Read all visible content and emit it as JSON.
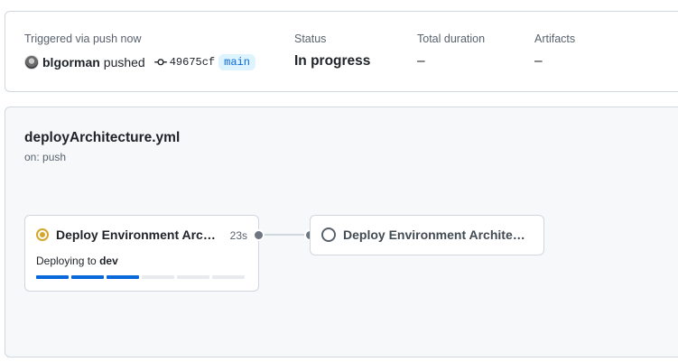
{
  "summary": {
    "triggered_label": "Triggered via push now",
    "user": "blgorman",
    "action": "pushed",
    "commit_sha": "49675cf",
    "branch": "main",
    "status_label": "Status",
    "status_value": "In progress",
    "duration_label": "Total duration",
    "duration_value": "–",
    "artifacts_label": "Artifacts",
    "artifacts_value": "–"
  },
  "workflow": {
    "file_name": "deployArchitecture.yml",
    "trigger": "on: push",
    "jobs": [
      {
        "name": "Deploy Environment Archit...",
        "status": "in_progress",
        "duration": "23s",
        "step_prefix": "Deploying to",
        "step_env": "dev",
        "progress_segments_done": 3,
        "progress_segments_total": 6
      },
      {
        "name": "Deploy Environment Architect...",
        "status": "queued"
      }
    ]
  },
  "colors": {
    "accent": "#0969da",
    "in_progress": "#d4a72c",
    "border": "#d0d7de"
  },
  "icons": {
    "commit": "git-commit-icon",
    "in_progress": "status-in-progress-icon",
    "queued": "status-queued-icon"
  }
}
